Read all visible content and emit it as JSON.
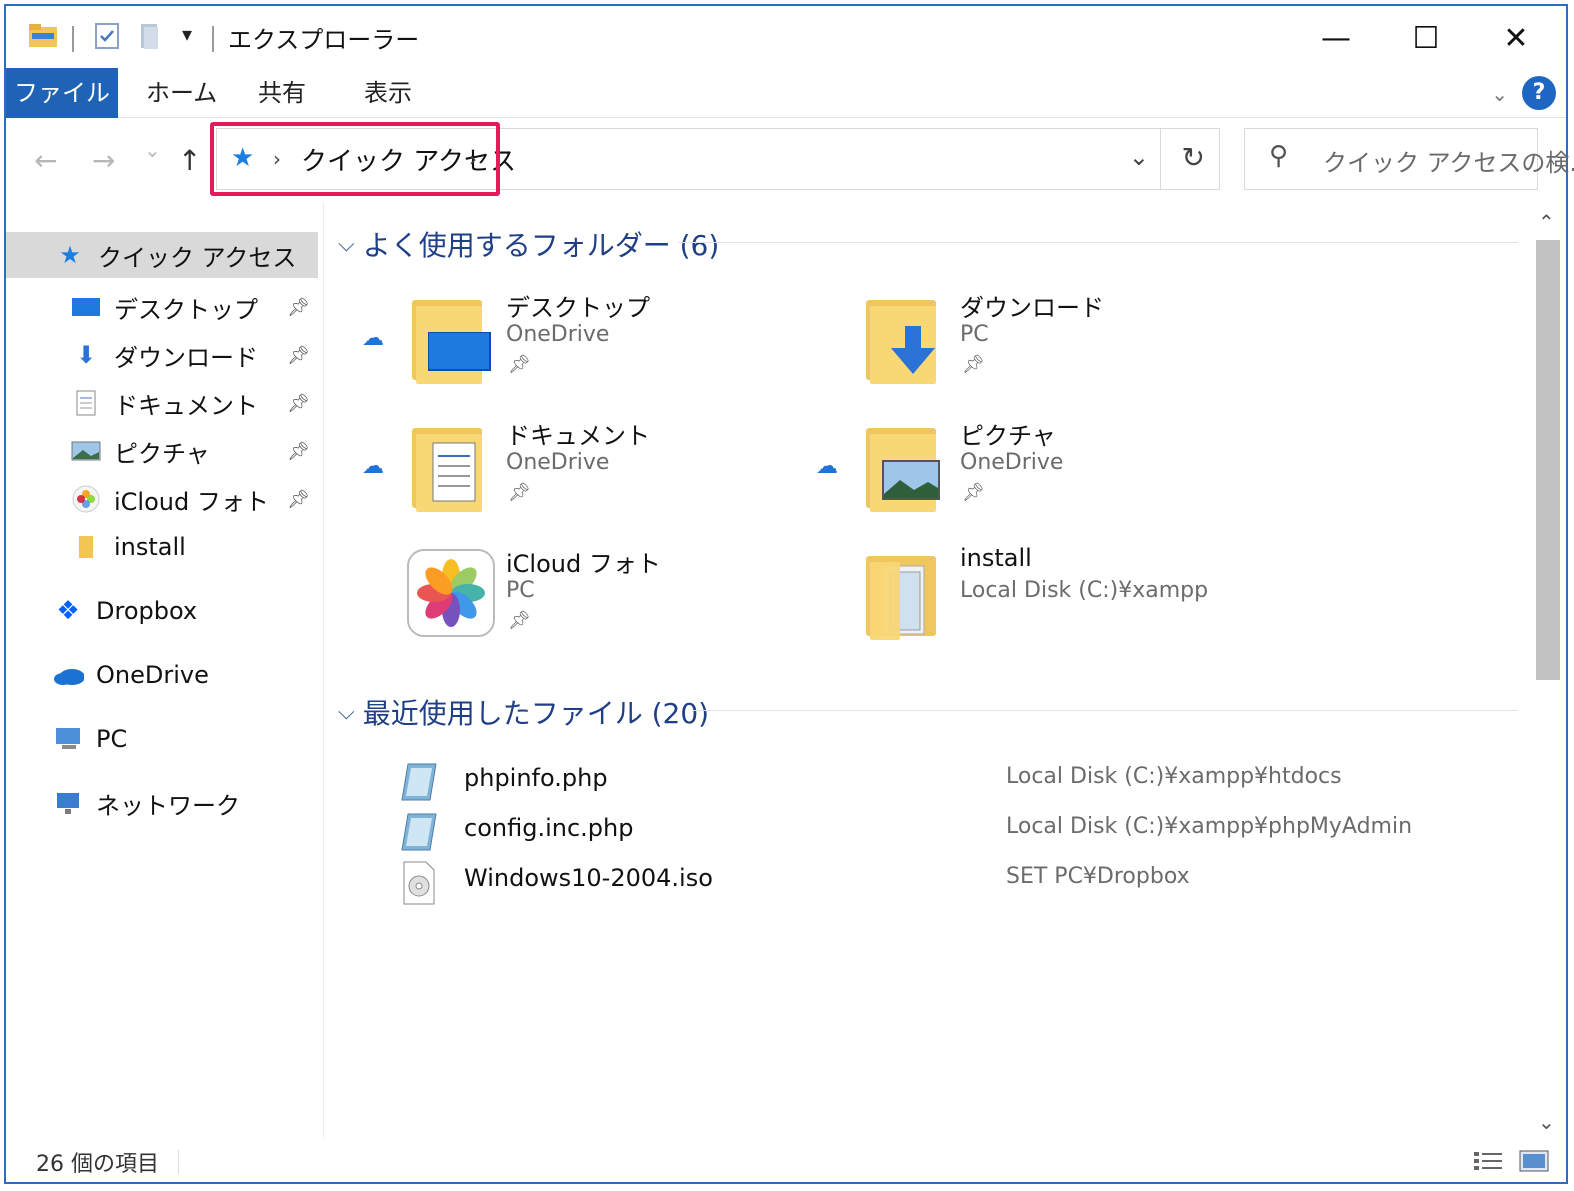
{
  "title_bar": {
    "title": "エクスプローラー",
    "minimize_glyph": "—",
    "maximize_glyph": "☐",
    "close_glyph": "✕"
  },
  "ribbon": {
    "tabs": [
      "ファイル",
      "ホーム",
      "共有",
      "表示"
    ],
    "help_glyph": "?"
  },
  "address_bar": {
    "location": "クイック アクセス",
    "back_glyph": "←",
    "forward_glyph": "→",
    "recent_glyph": "⌄",
    "up_glyph": "↑",
    "refresh_glyph": "↻"
  },
  "search": {
    "placeholder": "クイック アクセスの検..."
  },
  "nav_pane": {
    "quick_access": "クイック アクセス",
    "pinned": [
      {
        "label": "デスクトップ",
        "icon": "desktop-icon",
        "pinned": true
      },
      {
        "label": "ダウンロード",
        "icon": "download-icon",
        "pinned": true
      },
      {
        "label": "ドキュメント",
        "icon": "documents-icon",
        "pinned": true
      },
      {
        "label": "ピクチャ",
        "icon": "pictures-icon",
        "pinned": true
      },
      {
        "label": "iCloud フォト",
        "icon": "icloud-photos-icon",
        "pinned": true
      },
      {
        "label": "install",
        "icon": "folder-icon",
        "pinned": false
      }
    ],
    "roots": [
      {
        "label": "Dropbox",
        "icon": "dropbox-icon"
      },
      {
        "label": "OneDrive",
        "icon": "onedrive-icon"
      },
      {
        "label": "PC",
        "icon": "pc-icon"
      },
      {
        "label": "ネットワーク",
        "icon": "network-icon"
      }
    ]
  },
  "frequent_folders": {
    "header": "よく使用するフォルダー (6)",
    "items": [
      {
        "name": "デスクトップ",
        "location": "OneDrive",
        "cloud": true,
        "pinned": true
      },
      {
        "name": "ダウンロード",
        "location": "PC",
        "cloud": false,
        "pinned": true
      },
      {
        "name": "ドキュメント",
        "location": "OneDrive",
        "cloud": true,
        "pinned": true
      },
      {
        "name": "ピクチャ",
        "location": "OneDrive",
        "cloud": true,
        "pinned": true
      },
      {
        "name": "iCloud フォト",
        "location": "PC",
        "cloud": false,
        "pinned": true
      },
      {
        "name": "install",
        "location": "Local Disk (C:)¥xampp",
        "cloud": false,
        "pinned": false
      }
    ]
  },
  "recent_files": {
    "header": "最近使用したファイル (20)",
    "items": [
      {
        "name": "phpinfo.php",
        "path": "Local Disk (C:)¥xampp¥htdocs"
      },
      {
        "name": "config.inc.php",
        "path": "Local Disk (C:)¥xampp¥phpMyAdmin"
      },
      {
        "name": "Windows10-2004.iso",
        "path": "SET PC¥Dropbox"
      }
    ]
  },
  "status_bar": {
    "item_count": "26 個の項目"
  },
  "colors": {
    "accent": "#1e63b6",
    "highlight_border": "#e6195b",
    "section_header": "#1f3f86",
    "folder": "#f8d775"
  }
}
